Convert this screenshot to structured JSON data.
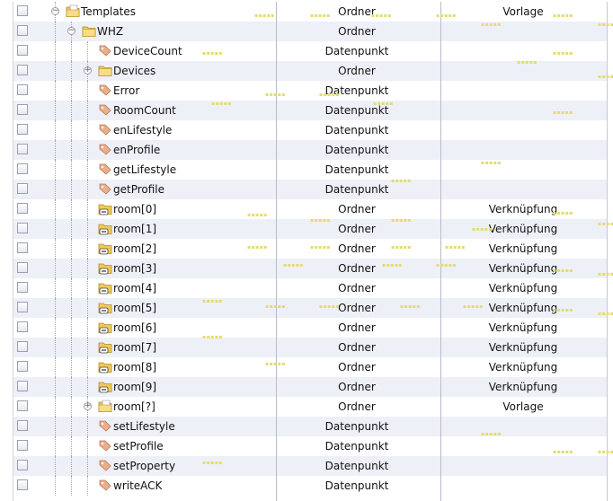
{
  "rows": [
    {
      "label": "Templates",
      "type": "Ordner",
      "role": "Vorlage",
      "icon": "folder-template-icon",
      "depth": 0,
      "toggle": "collapse"
    },
    {
      "label": "WHZ",
      "type": "Ordner",
      "role": "",
      "icon": "folder-icon",
      "depth": 1,
      "toggle": "collapse"
    },
    {
      "label": "DeviceCount",
      "type": "Datenpunkt",
      "role": "",
      "icon": "datapoint-tag-icon",
      "depth": 2,
      "toggle": ""
    },
    {
      "label": "Devices",
      "type": "Ordner",
      "role": "",
      "icon": "folder-icon",
      "depth": 2,
      "toggle": "expand"
    },
    {
      "label": "Error",
      "type": "Datenpunkt",
      "role": "",
      "icon": "datapoint-tag-icon",
      "depth": 2,
      "toggle": ""
    },
    {
      "label": "RoomCount",
      "type": "Datenpunkt",
      "role": "",
      "icon": "datapoint-tag-icon",
      "depth": 2,
      "toggle": ""
    },
    {
      "label": "enLifestyle",
      "type": "Datenpunkt",
      "role": "",
      "icon": "datapoint-tag-icon",
      "depth": 2,
      "toggle": ""
    },
    {
      "label": "enProfile",
      "type": "Datenpunkt",
      "role": "",
      "icon": "datapoint-tag-icon",
      "depth": 2,
      "toggle": ""
    },
    {
      "label": "getLifestyle",
      "type": "Datenpunkt",
      "role": "",
      "icon": "datapoint-tag-icon",
      "depth": 2,
      "toggle": ""
    },
    {
      "label": "getProfile",
      "type": "Datenpunkt",
      "role": "",
      "icon": "datapoint-tag-icon",
      "depth": 2,
      "toggle": ""
    },
    {
      "label": "room[0]",
      "type": "Ordner",
      "role": "Verknüpfung",
      "icon": "folder-link-icon",
      "depth": 2,
      "toggle": ""
    },
    {
      "label": "room[1]",
      "type": "Ordner",
      "role": "Verknüpfung",
      "icon": "folder-link-icon",
      "depth": 2,
      "toggle": ""
    },
    {
      "label": "room[2]",
      "type": "Ordner",
      "role": "Verknüpfung",
      "icon": "folder-link-icon",
      "depth": 2,
      "toggle": ""
    },
    {
      "label": "room[3]",
      "type": "Ordner",
      "role": "Verknüpfung",
      "icon": "folder-link-icon",
      "depth": 2,
      "toggle": ""
    },
    {
      "label": "room[4]",
      "type": "Ordner",
      "role": "Verknüpfung",
      "icon": "folder-link-icon",
      "depth": 2,
      "toggle": ""
    },
    {
      "label": "room[5]",
      "type": "Ordner",
      "role": "Verknüpfung",
      "icon": "folder-link-icon",
      "depth": 2,
      "toggle": ""
    },
    {
      "label": "room[6]",
      "type": "Ordner",
      "role": "Verknüpfung",
      "icon": "folder-link-icon",
      "depth": 2,
      "toggle": ""
    },
    {
      "label": "room[7]",
      "type": "Ordner",
      "role": "Verknüpfung",
      "icon": "folder-link-icon",
      "depth": 2,
      "toggle": ""
    },
    {
      "label": "room[8]",
      "type": "Ordner",
      "role": "Verknüpfung",
      "icon": "folder-link-icon",
      "depth": 2,
      "toggle": ""
    },
    {
      "label": "room[9]",
      "type": "Ordner",
      "role": "Verknüpfung",
      "icon": "folder-link-icon",
      "depth": 2,
      "toggle": ""
    },
    {
      "label": "room[?]",
      "type": "Ordner",
      "role": "Vorlage",
      "icon": "folder-template-icon",
      "depth": 2,
      "toggle": "expand"
    },
    {
      "label": "setLifestyle",
      "type": "Datenpunkt",
      "role": "",
      "icon": "datapoint-tag-icon",
      "depth": 2,
      "toggle": ""
    },
    {
      "label": "setProfile",
      "type": "Datenpunkt",
      "role": "",
      "icon": "datapoint-tag-icon",
      "depth": 2,
      "toggle": ""
    },
    {
      "label": "setProperty",
      "type": "Datenpunkt",
      "role": "",
      "icon": "datapoint-tag-icon",
      "depth": 2,
      "toggle": ""
    },
    {
      "label": "writeACK",
      "type": "Datenpunkt",
      "role": "",
      "icon": "datapoint-tag-icon",
      "depth": 2,
      "toggle": ""
    }
  ],
  "colors": {
    "row_alt": "#eef0f8",
    "folder": "#f1c95a",
    "tag": "#e8b08a",
    "watermark": "#e3dc70"
  }
}
